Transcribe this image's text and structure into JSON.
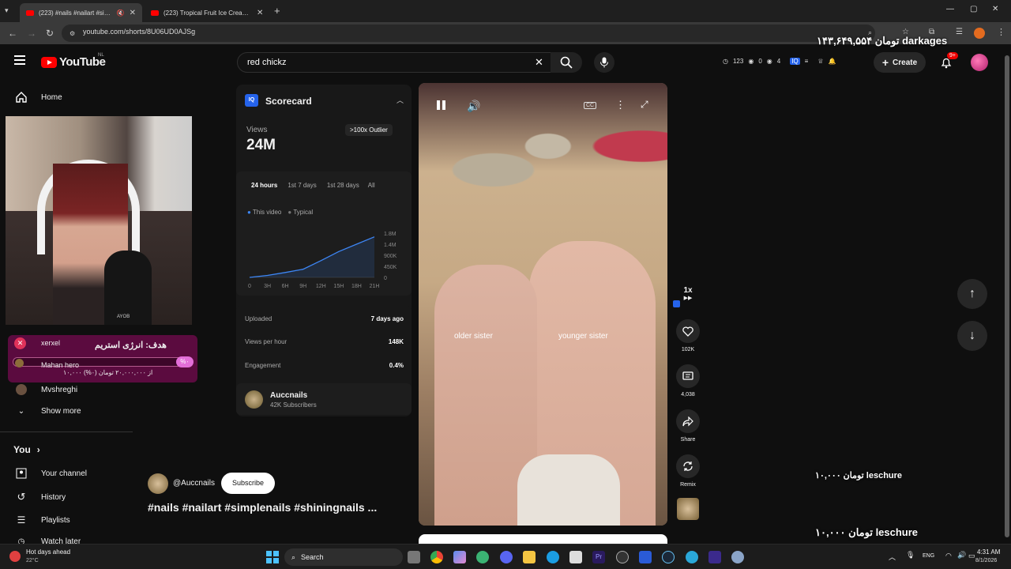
{
  "tabs": [
    {
      "label": "(223) #nails #nailart #simplen"
    },
    {
      "label": "(223) Tropical Fruit Ice Cream M"
    }
  ],
  "address": {
    "url": "youtube.com/shorts/8U06UD0AJSg"
  },
  "youtube": {
    "brand": "YouTube",
    "region": "NL"
  },
  "search": {
    "query": "red chickz"
  },
  "header": {
    "stats": {
      "a": "123",
      "b": "0",
      "c": "4"
    },
    "create_label": "Create",
    "notif_badge": "9+"
  },
  "sidebar": {
    "home": "Home",
    "items": [
      "Mvshreghi",
      "Show more"
    ],
    "you": "You",
    "you_items": [
      "Your channel",
      "History",
      "Playlists",
      "Watch later"
    ]
  },
  "stream": {
    "goal_title": "هدف: انرژی استریم",
    "goal_user": "xerxel",
    "goal_user2": "Mahan hero",
    "goal_progress": "۱۰,۰۰۰ از ۲۰,۰۰۰,۰۰۰ تومان (۰%)",
    "goal_percent_label": "%۰",
    "cam_label": "AYOB"
  },
  "scorecard": {
    "title": "Scorecard",
    "views_label": "Views",
    "views_value": "24M",
    "outlier": ">100x Outlier",
    "periods": [
      "24 hours",
      "1st 7 days",
      "1st 28 days",
      "All"
    ],
    "legend_this": "This video",
    "legend_typical": "Typical",
    "uploaded_label": "Uploaded",
    "uploaded_value": "7 days ago",
    "vph_label": "Views per hour",
    "vph_value": "148K",
    "eng_label": "Engagement",
    "eng_value": "0.4%",
    "channel_name": "Auccnails",
    "channel_subs": "42K Subscribers"
  },
  "chart_data": {
    "type": "line",
    "x": [
      "0",
      "3H",
      "6H",
      "9H",
      "12H",
      "15H",
      "18H",
      "21H"
    ],
    "y_ticks": [
      "1.8M",
      "1.4M",
      "900K",
      "450K",
      "0"
    ],
    "series": [
      {
        "name": "This video",
        "values": [
          0,
          80000,
          200000,
          330000,
          680000,
          1050000,
          1350000,
          1650000
        ]
      }
    ],
    "ylim": [
      0,
      1800000
    ],
    "colors": {
      "this": "#3d86f5",
      "typical": "#777777"
    }
  },
  "video": {
    "cc": "CC",
    "label_left": "older sister",
    "label_right": "younger sister",
    "channel": "@Auccnails",
    "subscribe": "Subscribe",
    "title": "#nails #nailart #simplenails #shiningnails ..."
  },
  "actions": {
    "speed": "1x",
    "likes": "102K",
    "comments": "4,038",
    "share": "Share",
    "remix": "Remix"
  },
  "donations": {
    "top": "۱۴۳,۶۴۹,۵۵۴ تومان darkages",
    "mid": "۱۰,۰۰۰ تومان leschure",
    "bottom": "۱۰,۰۰۰ تومان leschure"
  },
  "taskbar": {
    "weather_title": "Hot days ahead",
    "weather_temp": "22°C",
    "search": "Search",
    "lang": "ENG",
    "time": "4:31 AM",
    "date": "8/1/2026"
  }
}
